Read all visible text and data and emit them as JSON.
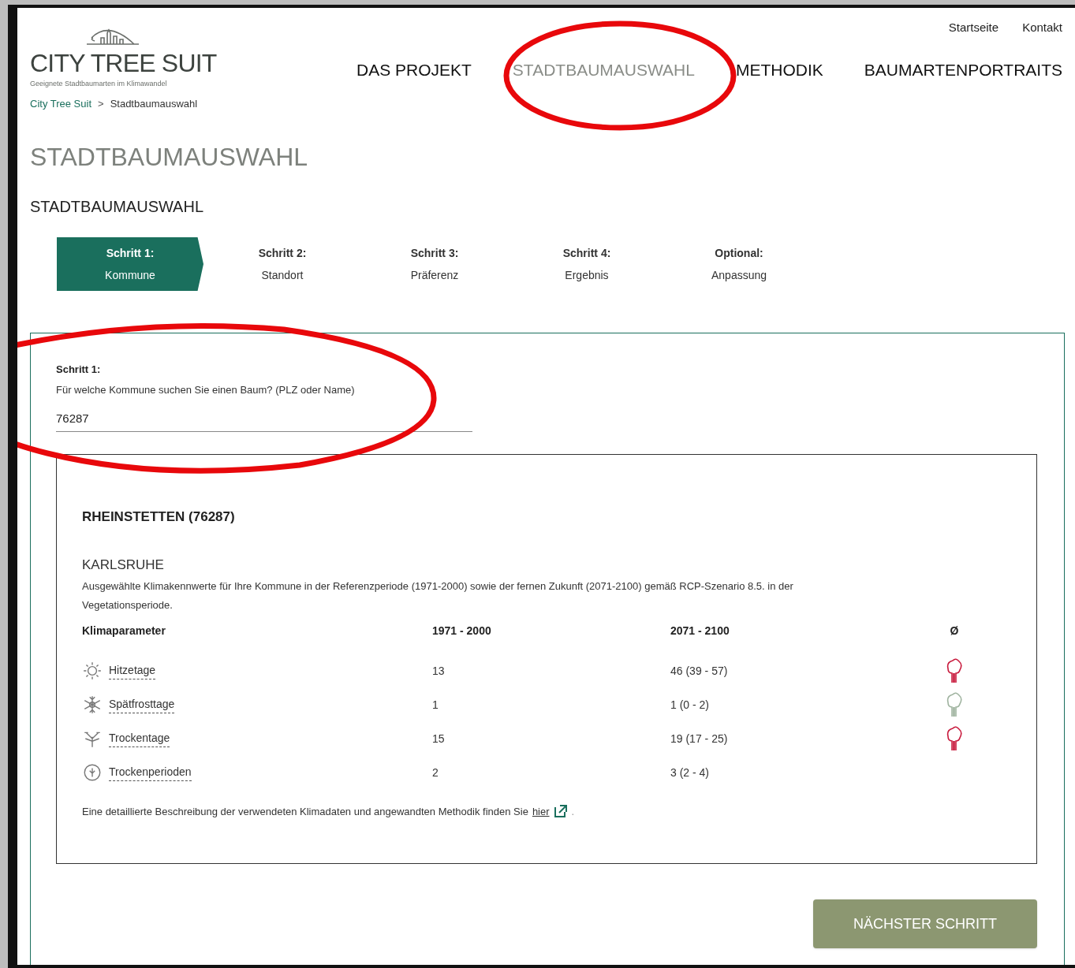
{
  "header": {
    "logo_title": "CITY TREE SUIT",
    "logo_subtitle": "Geeignete Stadtbaumarten im Klimawandel",
    "top_links": [
      "Startseite",
      "Kontakt"
    ],
    "nav": [
      {
        "label": "DAS PROJEKT",
        "selected": false
      },
      {
        "label": "STADTBAUMAUSWAHL",
        "selected": true
      },
      {
        "label": "METHODIK",
        "selected": false
      },
      {
        "label": "BAUMARTENPORTRAITS",
        "selected": false
      }
    ]
  },
  "breadcrumb": [
    "City Tree Suit",
    ">",
    "Stadtbaumauswahl"
  ],
  "page_title": "STADTBAUMAUSWAHL",
  "section_title": "STADTBAUMAUSWAHL",
  "steps": [
    {
      "label": "Schritt 1:",
      "sub": "Kommune",
      "selected": true
    },
    {
      "label": "Schritt 2:",
      "sub": "Standort",
      "selected": false
    },
    {
      "label": "Schritt 3:",
      "sub": "Präferenz",
      "selected": false
    },
    {
      "label": "Schritt 4:",
      "sub": "Ergebnis",
      "selected": false
    },
    {
      "label": "Optional:",
      "sub": "Anpassung",
      "selected": false
    }
  ],
  "form": {
    "step_label": "Schritt 1:",
    "question": "Für welche Kommune suchen Sie einen Baum? (PLZ oder Name)",
    "value": "76287"
  },
  "result": {
    "title": "RHEINSTETTEN (76287)",
    "district": "KARLSRUHE",
    "description": "Ausgewählte Klimakennwerte für Ihre Kommune in der Referenzperiode (1971-2000) sowie der fernen Zukunft (2071-2100) gemäß RCP-Szenario 8.5. in der Vegetationsperiode.",
    "columns": [
      "Klimaparameter",
      "1971 - 2000",
      "2071 - 2100",
      "Ø"
    ],
    "rows": [
      {
        "kind": "sun",
        "name": "Hitzetage",
        "ref": "13",
        "future": "46 (39 - 57)",
        "color": "#c8193c"
      },
      {
        "kind": "frost",
        "name": "Spätfrosttage",
        "ref": "1",
        "future": "1 (0 - 2)",
        "color": "#9fb39f"
      },
      {
        "kind": "drought",
        "name": "Trockentage",
        "ref": "15",
        "future": "19 (17 - 25)",
        "color": "#c8193c"
      },
      {
        "kind": "period",
        "name": "Trockenperioden",
        "ref": "2",
        "future": "3 (2 - 4)"
      }
    ],
    "footnote": "Eine detaillierte Beschreibung der verwendeten Klimadaten und angewandten Methodik finden Sie",
    "link": "hier",
    "trailing": "."
  },
  "next_button": "NÄCHSTER SCHRITT"
}
